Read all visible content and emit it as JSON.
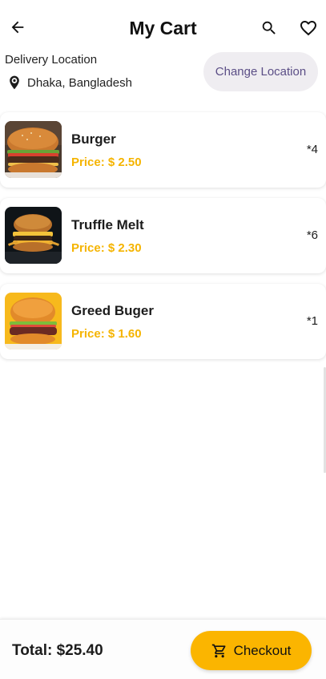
{
  "appbar": {
    "title": "My Cart",
    "back_icon": "arrow-left-icon",
    "search_icon": "search-icon",
    "favorite_icon": "heart-outline-icon"
  },
  "delivery": {
    "label": "Delivery Location",
    "location": "Dhaka, Bangladesh",
    "change_label": "Change Location",
    "pin_icon": "location-pin-icon"
  },
  "cart": {
    "items": [
      {
        "name": "Burger",
        "price": "Price: $ 2.50",
        "quantity": "*4"
      },
      {
        "name": "Truffle Melt",
        "price": "Price: $ 2.30",
        "quantity": "*6"
      },
      {
        "name": "Greed Buger",
        "price": "Price: $ 1.60",
        "quantity": "*1"
      }
    ]
  },
  "footer": {
    "total": "Total: $25.40",
    "checkout_label": "Checkout",
    "cart_icon": "shopping-cart-icon"
  },
  "colors": {
    "accent": "#fbb500",
    "price": "#f5b400",
    "change_button_bg": "#efedf1",
    "change_button_text": "#5b4e86"
  }
}
